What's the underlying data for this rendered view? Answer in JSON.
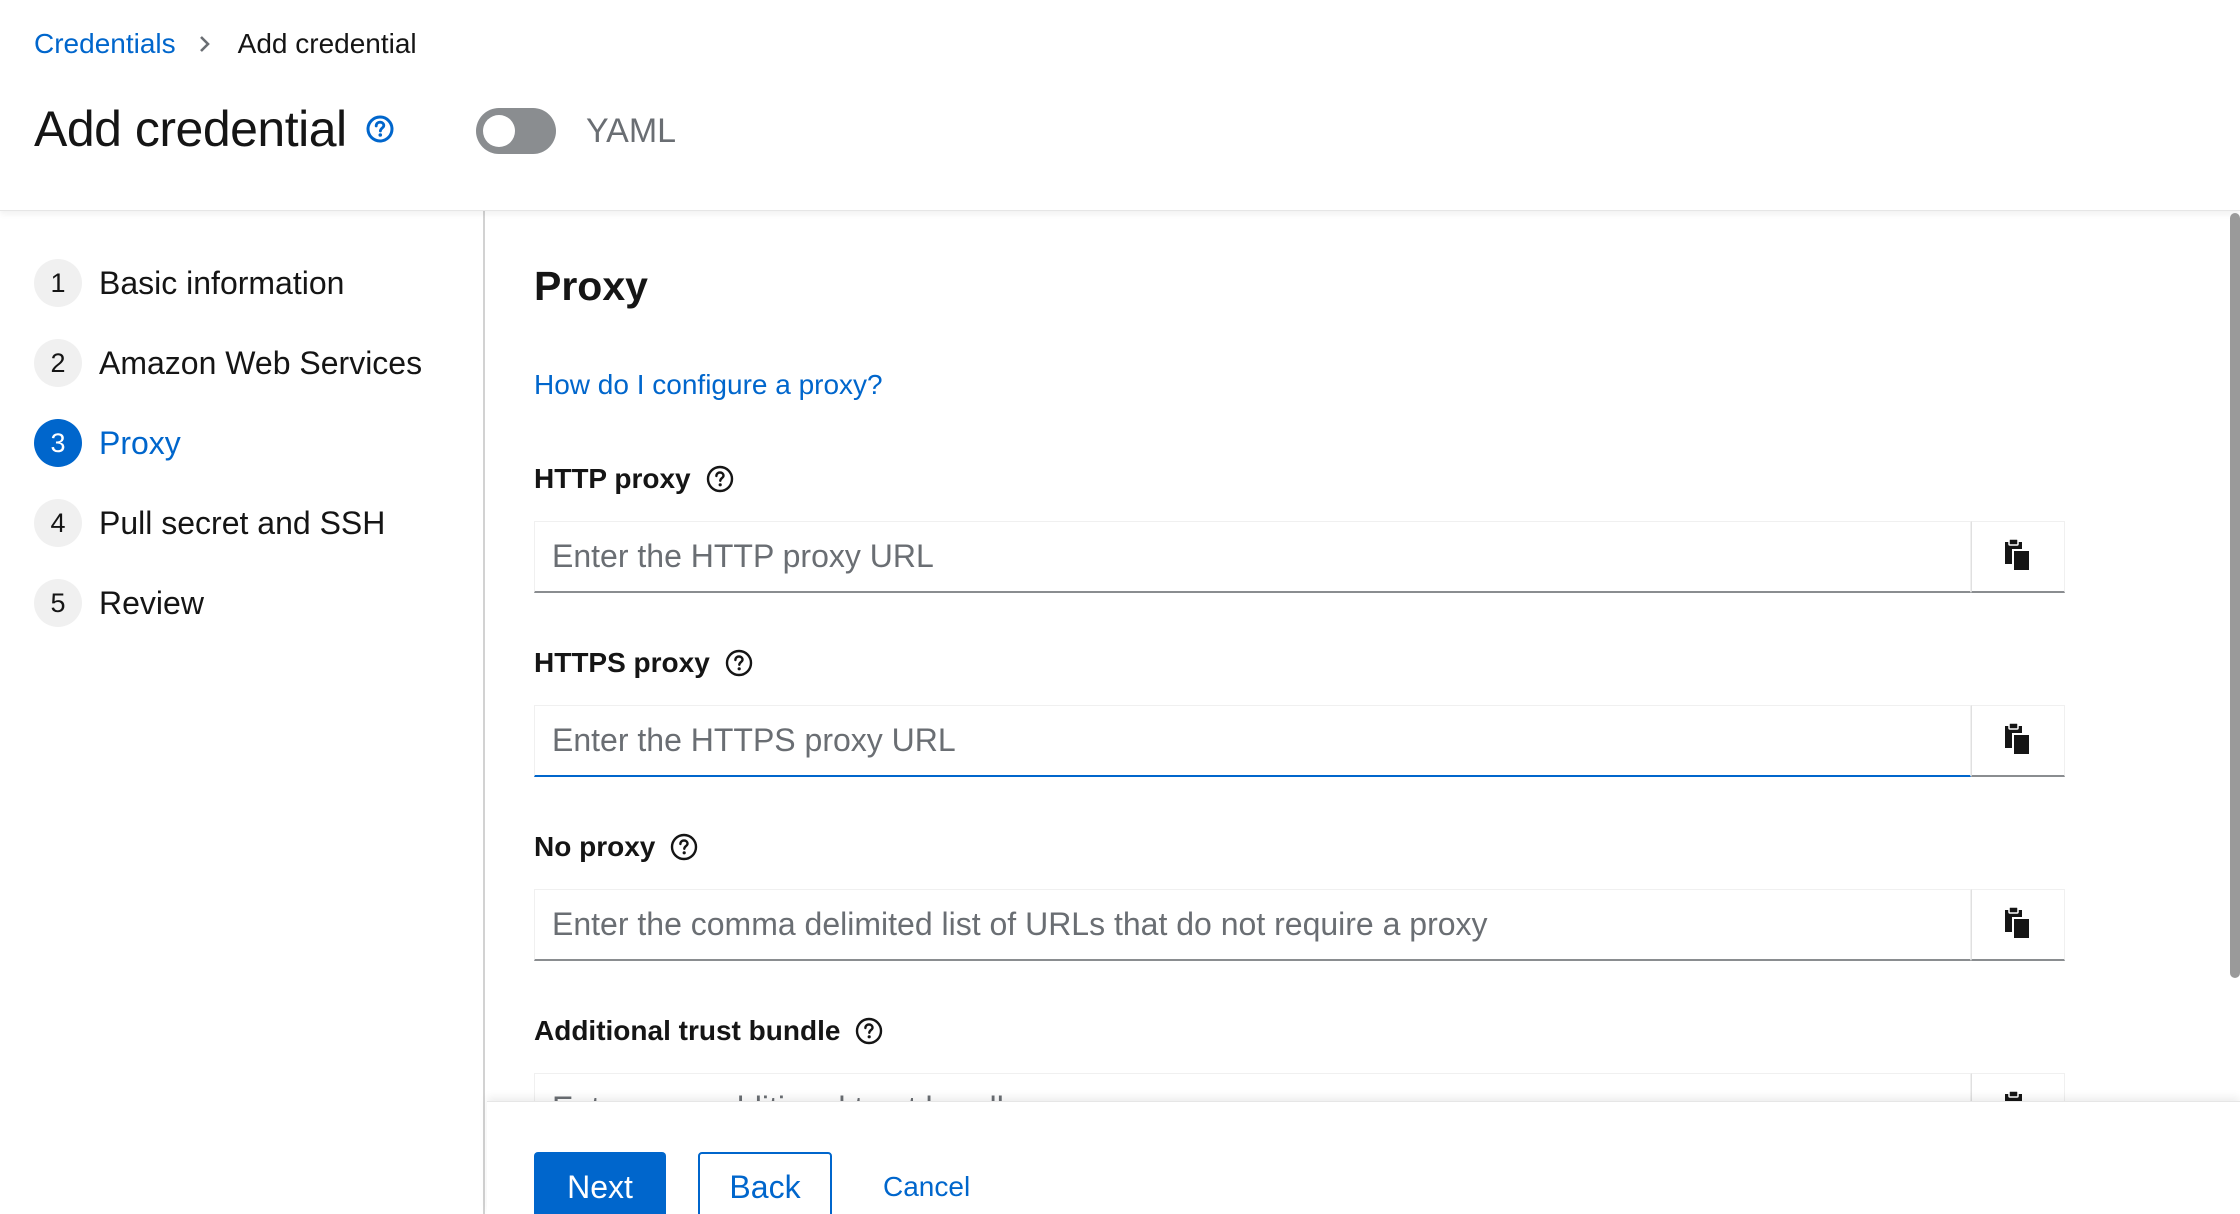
{
  "breadcrumb": {
    "parent": "Credentials",
    "current": "Add credential"
  },
  "header": {
    "title": "Add credential",
    "yaml_toggle_label": "YAML",
    "yaml_toggle_on": false
  },
  "wizard": {
    "steps": [
      {
        "number": "1",
        "label": "Basic information",
        "active": false
      },
      {
        "number": "2",
        "label": "Amazon Web Services",
        "active": false
      },
      {
        "number": "3",
        "label": "Proxy",
        "active": true
      },
      {
        "number": "4",
        "label": "Pull secret and SSH",
        "active": false
      },
      {
        "number": "5",
        "label": "Review",
        "active": false
      }
    ]
  },
  "main": {
    "section_title": "Proxy",
    "help_link": "How do I configure a proxy?",
    "fields": {
      "http_proxy": {
        "label": "HTTP proxy",
        "value": "",
        "placeholder": "Enter the HTTP proxy URL"
      },
      "https_proxy": {
        "label": "HTTPS proxy",
        "value": "",
        "placeholder": "Enter the HTTPS proxy URL"
      },
      "no_proxy": {
        "label": "No proxy",
        "value": "",
        "placeholder": "Enter the comma delimited list of URLs that do not require a proxy"
      },
      "trust_bundle": {
        "label": "Additional trust bundle",
        "value": "",
        "placeholder": "Enter your additional trust bundle"
      }
    }
  },
  "footer": {
    "next_label": "Next",
    "back_label": "Back",
    "cancel_label": "Cancel"
  },
  "colors": {
    "accent": "#0066cc",
    "text": "#151515",
    "placeholder": "#6a6e73"
  }
}
